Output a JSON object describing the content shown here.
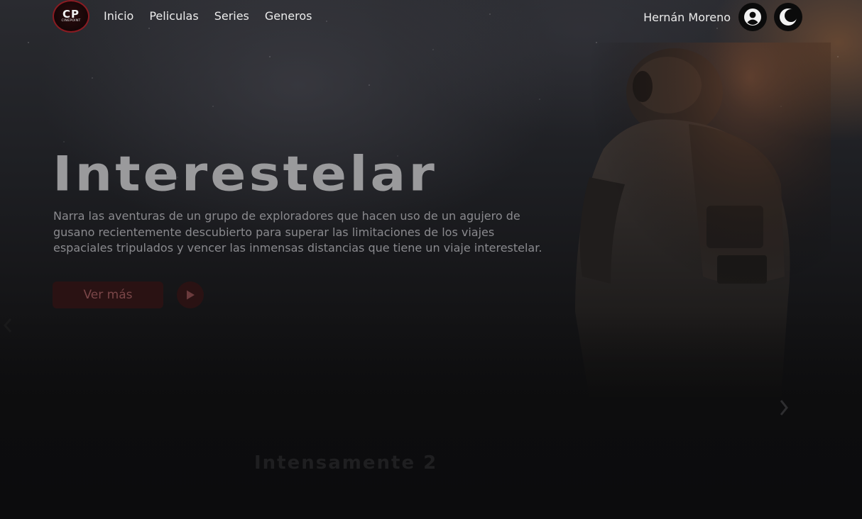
{
  "brand": {
    "logo_mark": "CP",
    "logo_text": "CINEPOINT",
    "accent_color": "#8a1b22"
  },
  "nav": {
    "items": [
      {
        "label": "Inicio"
      },
      {
        "label": "Peliculas"
      },
      {
        "label": "Series"
      },
      {
        "label": "Generos"
      }
    ]
  },
  "user": {
    "name": "Hernán Moreno",
    "avatar_icon": "user-icon",
    "theme_icon": "moon-icon"
  },
  "hero": {
    "title": "Interestelar",
    "description": "Narra las aventuras de un grupo de exploradores que hacen uso de un agujero de gusano recientemente descubierto para superar las limitaciones de los viajes espaciales tripulados y vencer las inmensas distancias que tiene un viaje interestelar.",
    "more_button": "Ver más",
    "play_icon": "play-icon"
  },
  "carousel": {
    "prev_icon": "chevron-left-icon",
    "next_icon": "chevron-right-icon",
    "next_title": "Intensamente 2"
  }
}
